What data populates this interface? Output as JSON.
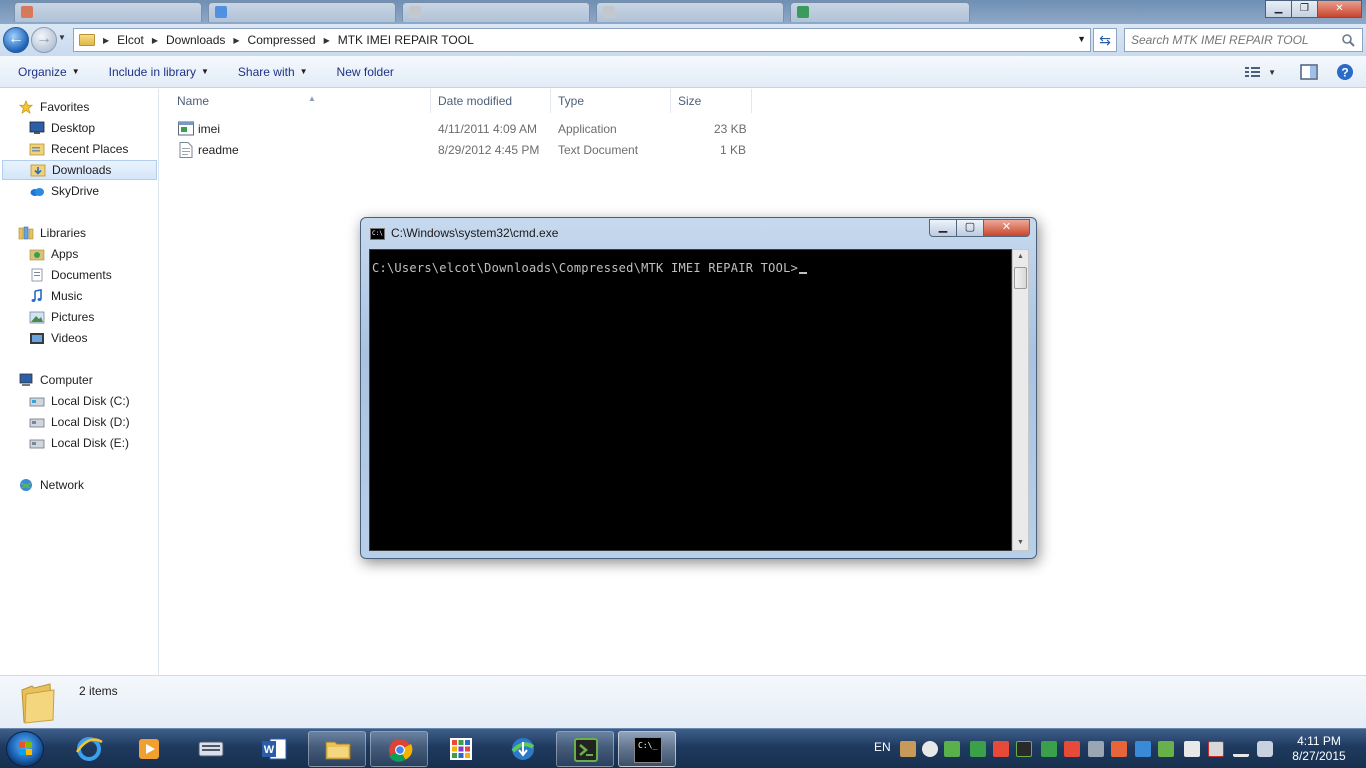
{
  "explorer": {
    "breadcrumb": [
      "Elcot",
      "Downloads",
      "Compressed",
      "MTK IMEI REPAIR TOOL"
    ],
    "search_placeholder": "Search MTK IMEI REPAIR TOOL",
    "toolbar": {
      "organize": "Organize",
      "include_in_library": "Include in library",
      "share_with": "Share with",
      "new_folder": "New folder"
    },
    "nav": {
      "favorites": "Favorites",
      "desktop": "Desktop",
      "recent_places": "Recent Places",
      "downloads": "Downloads",
      "skydrive": "SkyDrive",
      "libraries": "Libraries",
      "apps": "Apps",
      "documents": "Documents",
      "music": "Music",
      "pictures": "Pictures",
      "videos": "Videos",
      "computer": "Computer",
      "disk_c": "Local Disk (C:)",
      "disk_d": "Local Disk (D:)",
      "disk_e": "Local Disk (E:)",
      "network": "Network"
    },
    "columns": {
      "name": "Name",
      "date_modified": "Date modified",
      "type": "Type",
      "size": "Size"
    },
    "files": [
      {
        "name": "imei",
        "date": "4/11/2011 4:09 AM",
        "type": "Application",
        "size": "23 KB"
      },
      {
        "name": "readme",
        "date": "8/29/2012 4:45 PM",
        "type": "Text Document",
        "size": "1 KB"
      }
    ],
    "status": "2 items"
  },
  "cmd": {
    "title": "C:\\Windows\\system32\\cmd.exe",
    "icon_text": "C:\\",
    "prompt": "C:\\Users\\elcot\\Downloads\\Compressed\\MTK IMEI REPAIR TOOL>"
  },
  "taskbar": {
    "language": "EN",
    "time": "4:11 PM",
    "date": "8/27/2015",
    "cmd_icon_text": "C:\\_"
  },
  "colors": {
    "selection": "#d4e6fa",
    "link_text": "#1e3287",
    "console_bg": "#000000",
    "console_text": "#c0c0c0",
    "taskbar": "#1f3a5f"
  }
}
